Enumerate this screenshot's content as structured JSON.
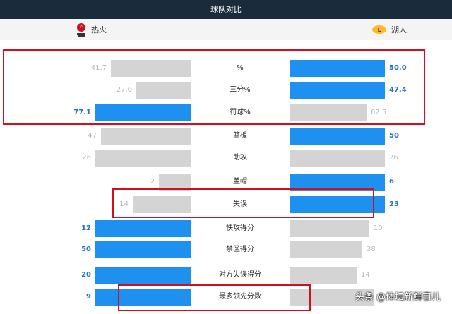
{
  "header": {
    "title": "球队对比"
  },
  "teams": {
    "left": {
      "name": "热火",
      "logo": "heat-logo"
    },
    "right": {
      "name": "湖人",
      "logo": "lakers-logo"
    }
  },
  "colors": {
    "win_bar": "#1e90f0",
    "lose_bar": "#d4d4d4",
    "header_bg": "#1a2b3c",
    "highlight": "#d0101f"
  },
  "stats": [
    {
      "label": "%",
      "left": "41.7",
      "right": "50.0",
      "leftWins": false
    },
    {
      "label": "三分%",
      "left": "27.0",
      "right": "47.4",
      "leftWins": false
    },
    {
      "label": "罚球%",
      "left": "77.1",
      "right": "62.5",
      "leftWins": true
    },
    {
      "label": "篮板",
      "left": "47",
      "right": "50",
      "leftWins": false
    },
    {
      "label": "助攻",
      "left": "26",
      "right": "26",
      "leftWins": null
    },
    {
      "label": "盖帽",
      "left": "2",
      "right": "6",
      "leftWins": false
    },
    {
      "label": "失误",
      "left": "14",
      "right": "23",
      "leftWins": false
    },
    {
      "label": "快攻得分",
      "left": "12",
      "right": "10",
      "leftWins": true
    },
    {
      "label": "禁区得分",
      "left": "50",
      "right": "38",
      "leftWins": true
    },
    {
      "label": "对方失误得分",
      "left": "20",
      "right": "14",
      "leftWins": true
    },
    {
      "label": "最多领先分数",
      "left": "9",
      "right": "8",
      "leftWins": true
    }
  ],
  "watermark": "头条 @体坛新鲜事儿"
}
